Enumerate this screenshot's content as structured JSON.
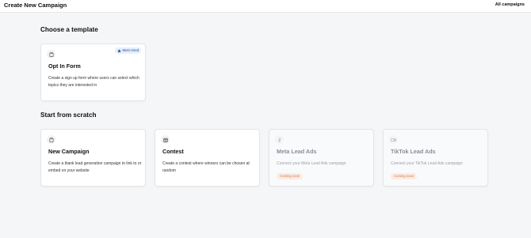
{
  "header": {
    "title": "Create New Campaign",
    "all_campaigns_label": "All campaigns"
  },
  "templates_section": {
    "title": "Choose a template",
    "cards": [
      {
        "icon": "clipboard-icon",
        "badge": "Most Used",
        "badge_icon": "star-icon",
        "title": "Opt In Form",
        "description": "Create a sign up form where users can select which topics they are interested in"
      }
    ]
  },
  "scratch_section": {
    "title": "Start from scratch",
    "cards": [
      {
        "icon": "clipboard-icon",
        "title": "New Campaign",
        "description": "Create a blank lead generation campaign to link to or embed on your website"
      },
      {
        "icon": "calendar-icon",
        "title": "Contest",
        "description": "Create a contest where winners can be chosen at random"
      },
      {
        "icon": "facebook-icon",
        "title": "Meta Lead Ads",
        "description": "Connect your Meta Lead Ads campaign",
        "badge": "Coming soon"
      },
      {
        "icon": "video-icon",
        "title": "TikTok Lead Ads",
        "description": "Connect your TikTok Lead Ads campaign",
        "badge": "Coming soon"
      }
    ]
  },
  "colors": {
    "background": "#f5f6f7",
    "most_used_badge_bg": "#e6efff",
    "coming_soon_badge_bg": "#fdebe2",
    "coming_soon_text": "#d07c55"
  }
}
